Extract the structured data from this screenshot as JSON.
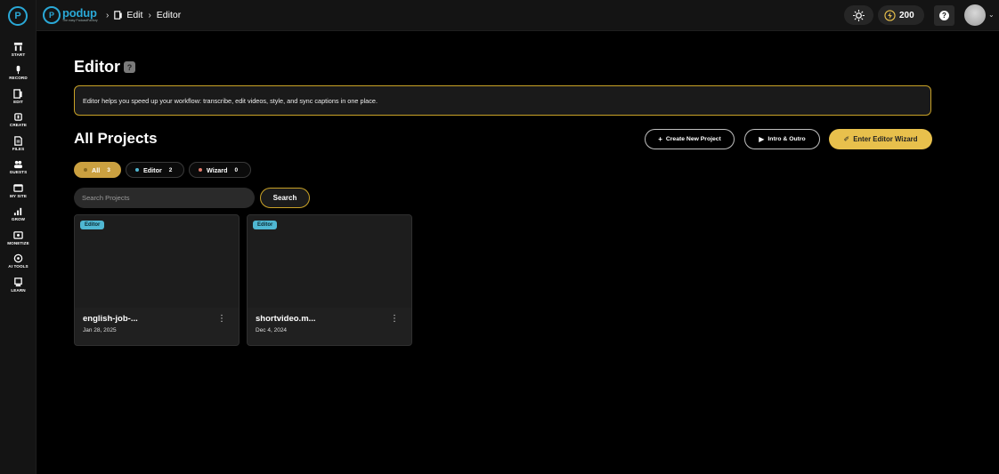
{
  "brand": {
    "name": "podup",
    "tagline": "The easy PodcastFactory"
  },
  "breadcrumb": [
    {
      "label": "Edit",
      "icon": "edit-icon"
    },
    {
      "label": "Editor"
    }
  ],
  "topbar": {
    "credits": "200",
    "theme_icon": "sun-icon",
    "credits_icon": "lightning-icon",
    "help_icon": "question-icon"
  },
  "sidebar": {
    "items": [
      {
        "label": "START",
        "icon": "start-icon"
      },
      {
        "label": "RECORD",
        "icon": "mic-icon"
      },
      {
        "label": "EDIT",
        "icon": "edit-icon"
      },
      {
        "label": "CREATE",
        "icon": "create-icon"
      },
      {
        "label": "FILES",
        "icon": "files-icon"
      },
      {
        "label": "GUESTS",
        "icon": "guests-icon"
      },
      {
        "label": "MY SITE",
        "icon": "site-icon"
      },
      {
        "label": "GROW",
        "icon": "grow-icon"
      },
      {
        "label": "MONETIZE",
        "icon": "monetize-icon"
      },
      {
        "label": "AI TOOLS",
        "icon": "ai-icon"
      },
      {
        "label": "LEARN",
        "icon": "learn-icon"
      }
    ]
  },
  "page": {
    "title": "Editor",
    "banner": "Editor helps you speed up your workflow: transcribe, edit videos, style, and sync captions in one place.",
    "section_title": "All Projects"
  },
  "actions": {
    "create": "Create New Project",
    "intro": "Intro & Outro",
    "wizard": "Enter Editor Wizard"
  },
  "filters": [
    {
      "label": "All",
      "count": "3",
      "dot": "#caa040"
    },
    {
      "label": "Editor",
      "count": "2",
      "dot": "#4fb7d2"
    },
    {
      "label": "Wizard",
      "count": "0",
      "dot": "#e07a6a"
    }
  ],
  "search": {
    "placeholder": "Search Projects",
    "button": "Search"
  },
  "projects": [
    {
      "badge": "Editor",
      "name": "english-job-...",
      "date": "Jan 28, 2025"
    },
    {
      "badge": "Editor",
      "name": "shortvideo.m...",
      "date": "Dec 4, 2024"
    }
  ],
  "colors": {
    "accent": "#e8c04c",
    "brand": "#2aa8d6",
    "badge": "#4fb7d2"
  }
}
